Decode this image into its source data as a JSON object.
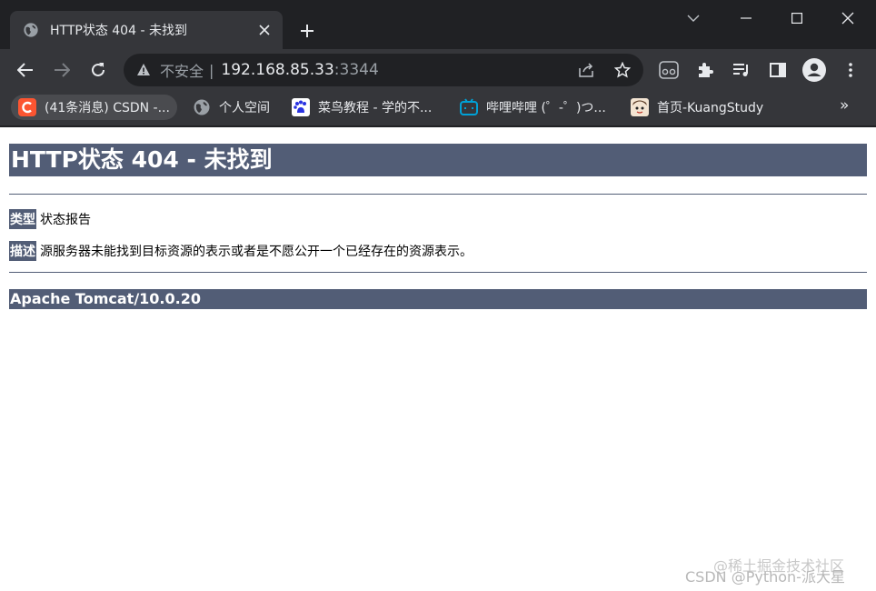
{
  "browser": {
    "tab_title": "HTTP状态 404 - 未找到",
    "address": {
      "security_label": "不安全",
      "separator": "|",
      "host": "192.168.85.33",
      "port": ":3344"
    },
    "bookmarks": [
      {
        "label": "(41条消息) CSDN -...",
        "icon": "csdn-icon"
      },
      {
        "label": "个人空间",
        "icon": "globe-icon"
      },
      {
        "label": "菜鸟教程 - 学的不...",
        "icon": "baidu-paw-icon"
      },
      {
        "label": "哔哩哔哩 (゜-゜)つ...",
        "icon": "bilibili-icon"
      },
      {
        "label": "首页-KuangStudy",
        "icon": "avatar-icon"
      }
    ],
    "bookmarks_overflow": "»"
  },
  "page": {
    "title": "HTTP状态 404 - 未找到",
    "type_key": "类型",
    "type_value": "状态报告",
    "desc_key": "描述",
    "desc_value": "源服务器未能找到目标资源的表示或者是不愿公开一个已经存在的资源表示。",
    "server": "Apache Tomcat/10.0.20"
  },
  "watermark": {
    "line1": "@稀土掘金技术社区",
    "line2": "CSDN @Python-派大星"
  },
  "colors": {
    "tomcat_header": "#525d76",
    "chrome_dark": "#202124",
    "chrome_toolbar": "#35363a"
  }
}
